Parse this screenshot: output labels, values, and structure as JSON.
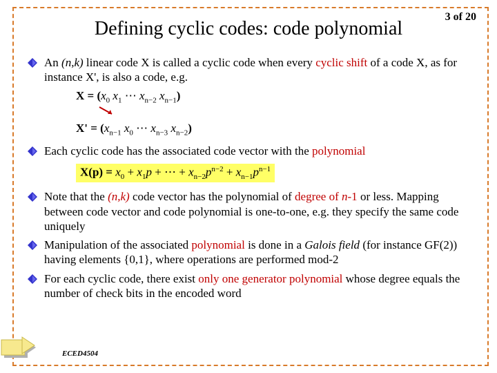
{
  "page": {
    "counter": "3 of 20"
  },
  "title": "Defining cyclic codes: code polynomial",
  "bullets": {
    "b1a": "An ",
    "b1b": "(n,k)",
    "b1c": " linear code X is called a cyclic code when every ",
    "b1d": "cyclic shift",
    "b1e": " of a code X, as for instance X', is also a code, e.g.",
    "b2a": "Each cyclic code has the associated code vector with the ",
    "b2b": "polynomial",
    "b3a": "Note that the ",
    "b3b": "(n,k)",
    "b3c": " code vector has the polynomial of ",
    "b3d": "degree of ",
    "b3e": "n",
    "b3f": "-1",
    "b3g": " or less. Mapping between code vector and code polynomial is one-to-one, e.g. they specify the same code uniquely",
    "b4a": "Manipulation of the associated ",
    "b4b": "polynomial",
    "b4c": " is done in  a ",
    "b4d": "Galois field",
    "b4e": " (for instance GF(2)) having elements {0,1}, where operations are performed mod-2",
    "b5a": "For each cyclic code, there exist ",
    "b5b": "only one generator polynomial",
    "b5c": " whose degree equals the number of check bits in the encoded word"
  },
  "eq": {
    "l1_pre": "X = (",
    "l1_x0": "x",
    "l1_0": "0",
    "l1_sp1": " ",
    "l1_x1": "x",
    "l1_1": "1",
    "l1_mid": " ⋯ ",
    "l1_xn2": "x",
    "l1_n2": "n−2",
    "l1_sp2": " ",
    "l1_xn1": "x",
    "l1_n1": "n−1",
    "l1_post": ")",
    "l2_pre": "X' = (",
    "l2_a": "x",
    "l2_as": "n−1",
    "l2_sp1": " ",
    "l2_b": "x",
    "l2_bs": "0",
    "l2_mid": " ⋯ ",
    "l2_c": "x",
    "l2_cs": "n−3",
    "l2_sp2": " ",
    "l2_d": "x",
    "l2_ds": "n−2",
    "l2_post": ")",
    "poly_pre": "X(p) = ",
    "poly_x0": "x",
    "poly_0": "0",
    "poly_plus1": " + ",
    "poly_x1": "x",
    "poly_1": "1",
    "poly_p1": "p",
    "poly_plus2": " + ⋯ + ",
    "poly_xn2": "x",
    "poly_n2s": "n−2",
    "poly_p2": "p",
    "poly_e2": "n−2",
    "poly_plus3": " + ",
    "poly_xn1": "x",
    "poly_n1s": "n−1",
    "poly_p3": "p",
    "poly_e3": "n−1"
  },
  "footer": "ECED4504"
}
